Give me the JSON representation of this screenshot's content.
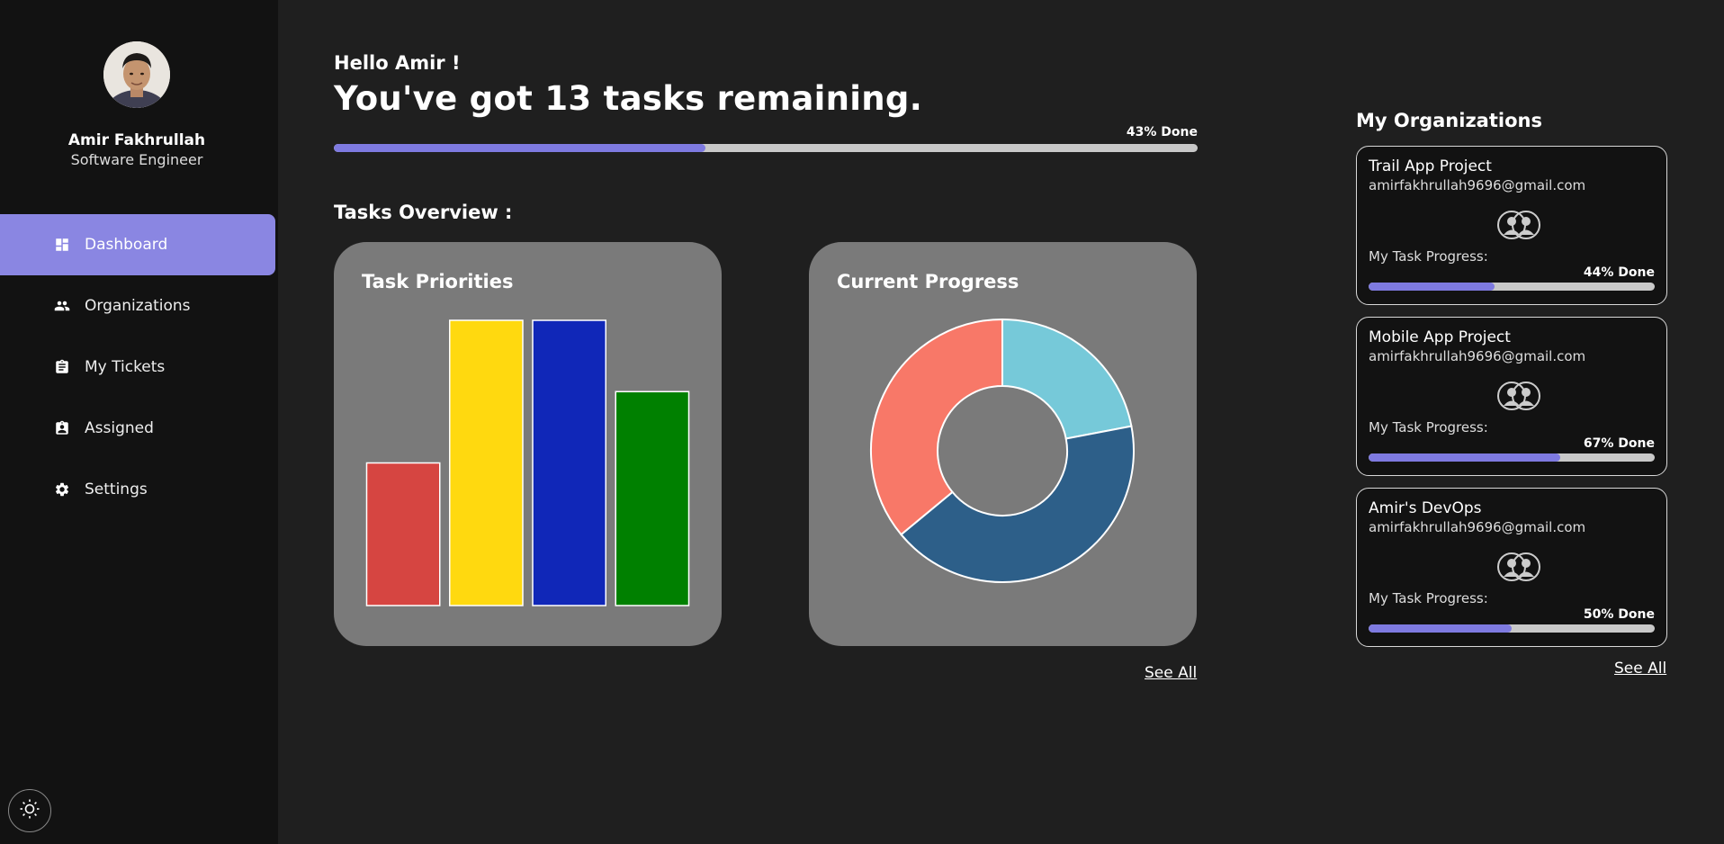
{
  "user": {
    "name": "Amir Fakhrullah",
    "role": "Software Engineer"
  },
  "nav": {
    "items": [
      {
        "label": "Dashboard",
        "icon": "dashboard-icon",
        "active": true
      },
      {
        "label": "Organizations",
        "icon": "people-icon",
        "active": false
      },
      {
        "label": "My Tickets",
        "icon": "clipboard-icon",
        "active": false
      },
      {
        "label": "Assigned",
        "icon": "assigned-icon",
        "active": false
      },
      {
        "label": "Settings",
        "icon": "gear-icon",
        "active": false
      }
    ]
  },
  "theme_toggle": {
    "icon": "sun-icon"
  },
  "header": {
    "greeting": "Hello Amir !",
    "headline": "You've got 13 tasks remaining.",
    "progress_label": "43% Done",
    "progress_fraction": 0.43
  },
  "overview": {
    "title": "Tasks Overview :",
    "see_all": "See All"
  },
  "chart_data": [
    {
      "type": "bar",
      "title": "Task Priorities",
      "categories": [
        "",
        "",
        "",
        ""
      ],
      "values": [
        5,
        10,
        10,
        7.5
      ],
      "colors": [
        "#d64541",
        "#ffd90f",
        "#1027b8",
        "#008000"
      ],
      "ylim": [
        0,
        10
      ],
      "grid": false
    },
    {
      "type": "pie",
      "title": "Current Progress",
      "values": [
        22,
        42,
        36
      ],
      "colors": [
        "#76c9d9",
        "#2d5f89",
        "#f87868"
      ],
      "donut": true
    }
  ],
  "organizations": {
    "title": "My Organizations",
    "progress_label": "My Task Progress:",
    "see_all": "See All",
    "items": [
      {
        "name": "Trail App Project",
        "email": "amirfakhrullah9696@gmail.com",
        "done_label": "44% Done",
        "fraction": 0.44
      },
      {
        "name": "Mobile App Project",
        "email": "amirfakhrullah9696@gmail.com",
        "done_label": "67% Done",
        "fraction": 0.67
      },
      {
        "name": "Amir's DevOps",
        "email": "amirfakhrullah9696@gmail.com",
        "done_label": "50% Done",
        "fraction": 0.5
      }
    ]
  }
}
